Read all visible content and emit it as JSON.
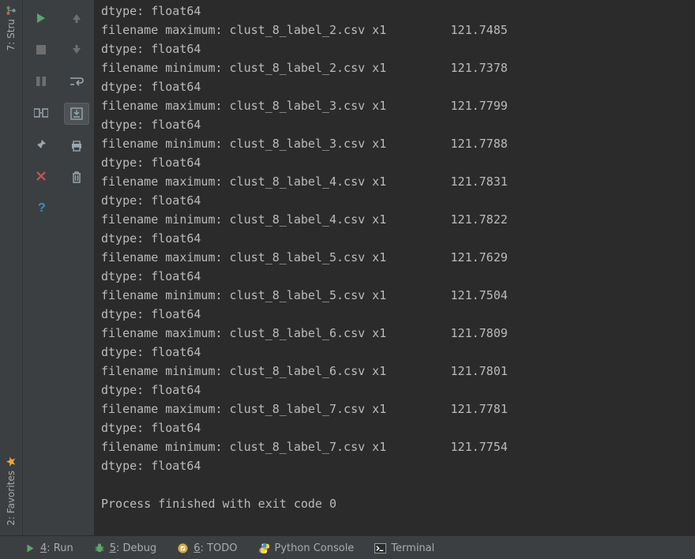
{
  "left_vertical_tabs": {
    "structure": "7: Stru",
    "favorites": "2: Favorites"
  },
  "console": {
    "records": [
      {
        "head": "dtype: float64"
      },
      {
        "stat": "maximum",
        "file": "clust_8_label_2.csv",
        "mult": "x1",
        "val": "121.7485"
      },
      {
        "head": "dtype: float64"
      },
      {
        "stat": "minimum",
        "file": "clust_8_label_2.csv",
        "mult": "x1",
        "val": "121.7378"
      },
      {
        "head": "dtype: float64"
      },
      {
        "stat": "maximum",
        "file": "clust_8_label_3.csv",
        "mult": "x1",
        "val": "121.7799"
      },
      {
        "head": "dtype: float64"
      },
      {
        "stat": "minimum",
        "file": "clust_8_label_3.csv",
        "mult": "x1",
        "val": "121.7788"
      },
      {
        "head": "dtype: float64"
      },
      {
        "stat": "maximum",
        "file": "clust_8_label_4.csv",
        "mult": "x1",
        "val": "121.7831"
      },
      {
        "head": "dtype: float64"
      },
      {
        "stat": "minimum",
        "file": "clust_8_label_4.csv",
        "mult": "x1",
        "val": "121.7822"
      },
      {
        "head": "dtype: float64"
      },
      {
        "stat": "maximum",
        "file": "clust_8_label_5.csv",
        "mult": "x1",
        "val": "121.7629"
      },
      {
        "head": "dtype: float64"
      },
      {
        "stat": "minimum",
        "file": "clust_8_label_5.csv",
        "mult": "x1",
        "val": "121.7504"
      },
      {
        "head": "dtype: float64"
      },
      {
        "stat": "maximum",
        "file": "clust_8_label_6.csv",
        "mult": "x1",
        "val": "121.7809"
      },
      {
        "head": "dtype: float64"
      },
      {
        "stat": "minimum",
        "file": "clust_8_label_6.csv",
        "mult": "x1",
        "val": "121.7801"
      },
      {
        "head": "dtype: float64"
      },
      {
        "stat": "maximum",
        "file": "clust_8_label_7.csv",
        "mult": "x1",
        "val": "121.7781"
      },
      {
        "head": "dtype: float64"
      },
      {
        "stat": "minimum",
        "file": "clust_8_label_7.csv",
        "mult": "x1",
        "val": "121.7754"
      },
      {
        "head": "dtype: float64"
      }
    ],
    "exit_message": "Process finished with exit code 0"
  },
  "bottom_bar": {
    "run": {
      "mnemonic": "4",
      "label": ": Run"
    },
    "debug": {
      "mnemonic": "5",
      "label": ": Debug"
    },
    "todo": {
      "mnemonic": "6",
      "label": ": TODO"
    },
    "python": {
      "label": "Python Console"
    },
    "terminal": {
      "label": "Terminal"
    }
  }
}
